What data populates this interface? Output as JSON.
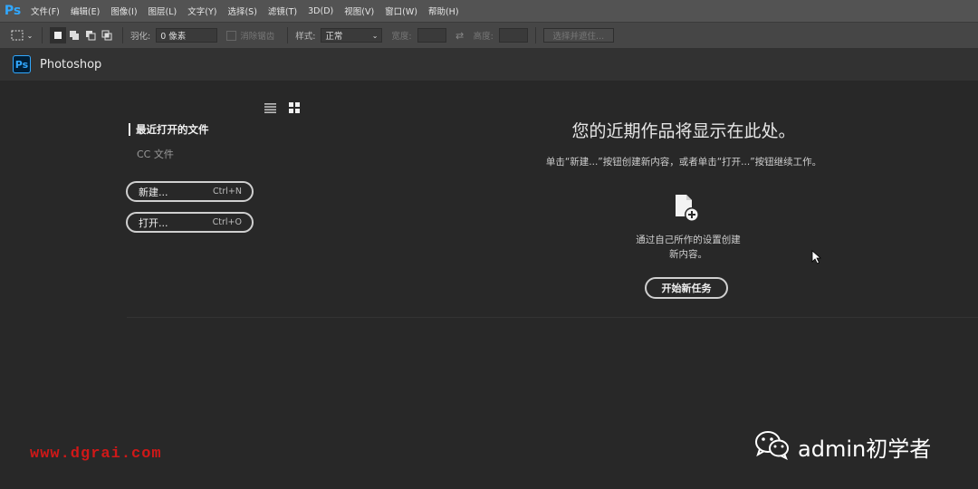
{
  "menubar": {
    "logo": "Ps",
    "items": [
      "文件(F)",
      "编辑(E)",
      "图像(I)",
      "图层(L)",
      "文字(Y)",
      "选择(S)",
      "滤镜(T)",
      "3D(D)",
      "视图(V)",
      "窗口(W)",
      "帮助(H)"
    ]
  },
  "options": {
    "feather_label": "羽化:",
    "feather_value": "0 像素",
    "antialias_label": "消除锯齿",
    "style_label": "样式:",
    "style_value": "正常",
    "width_label": "宽度:",
    "height_label": "高度:",
    "select_mask_label": "选择并遮住..."
  },
  "app": {
    "badge": "Ps",
    "title": "Photoshop"
  },
  "left_panel": {
    "heading": "最近打开的文件",
    "cc_files": "CC 文件",
    "new_label": "新建...",
    "new_shortcut": "Ctrl+N",
    "open_label": "打开...",
    "open_shortcut": "Ctrl+O"
  },
  "main": {
    "title": "您的近期作品将显示在此处。",
    "description": "单击“新建...”按钮创建新内容，或者单击“打开...”按钮继续工作。",
    "caption_line1": "通过自己所作的设置创建",
    "caption_line2": "新内容。",
    "start_button": "开始新任务"
  },
  "watermarks": {
    "url": "www.dgrai.com",
    "account": "admin初学者"
  },
  "colors": {
    "ps_blue": "#31a8ff",
    "background": "#282828",
    "watermark_red": "#d01818"
  }
}
